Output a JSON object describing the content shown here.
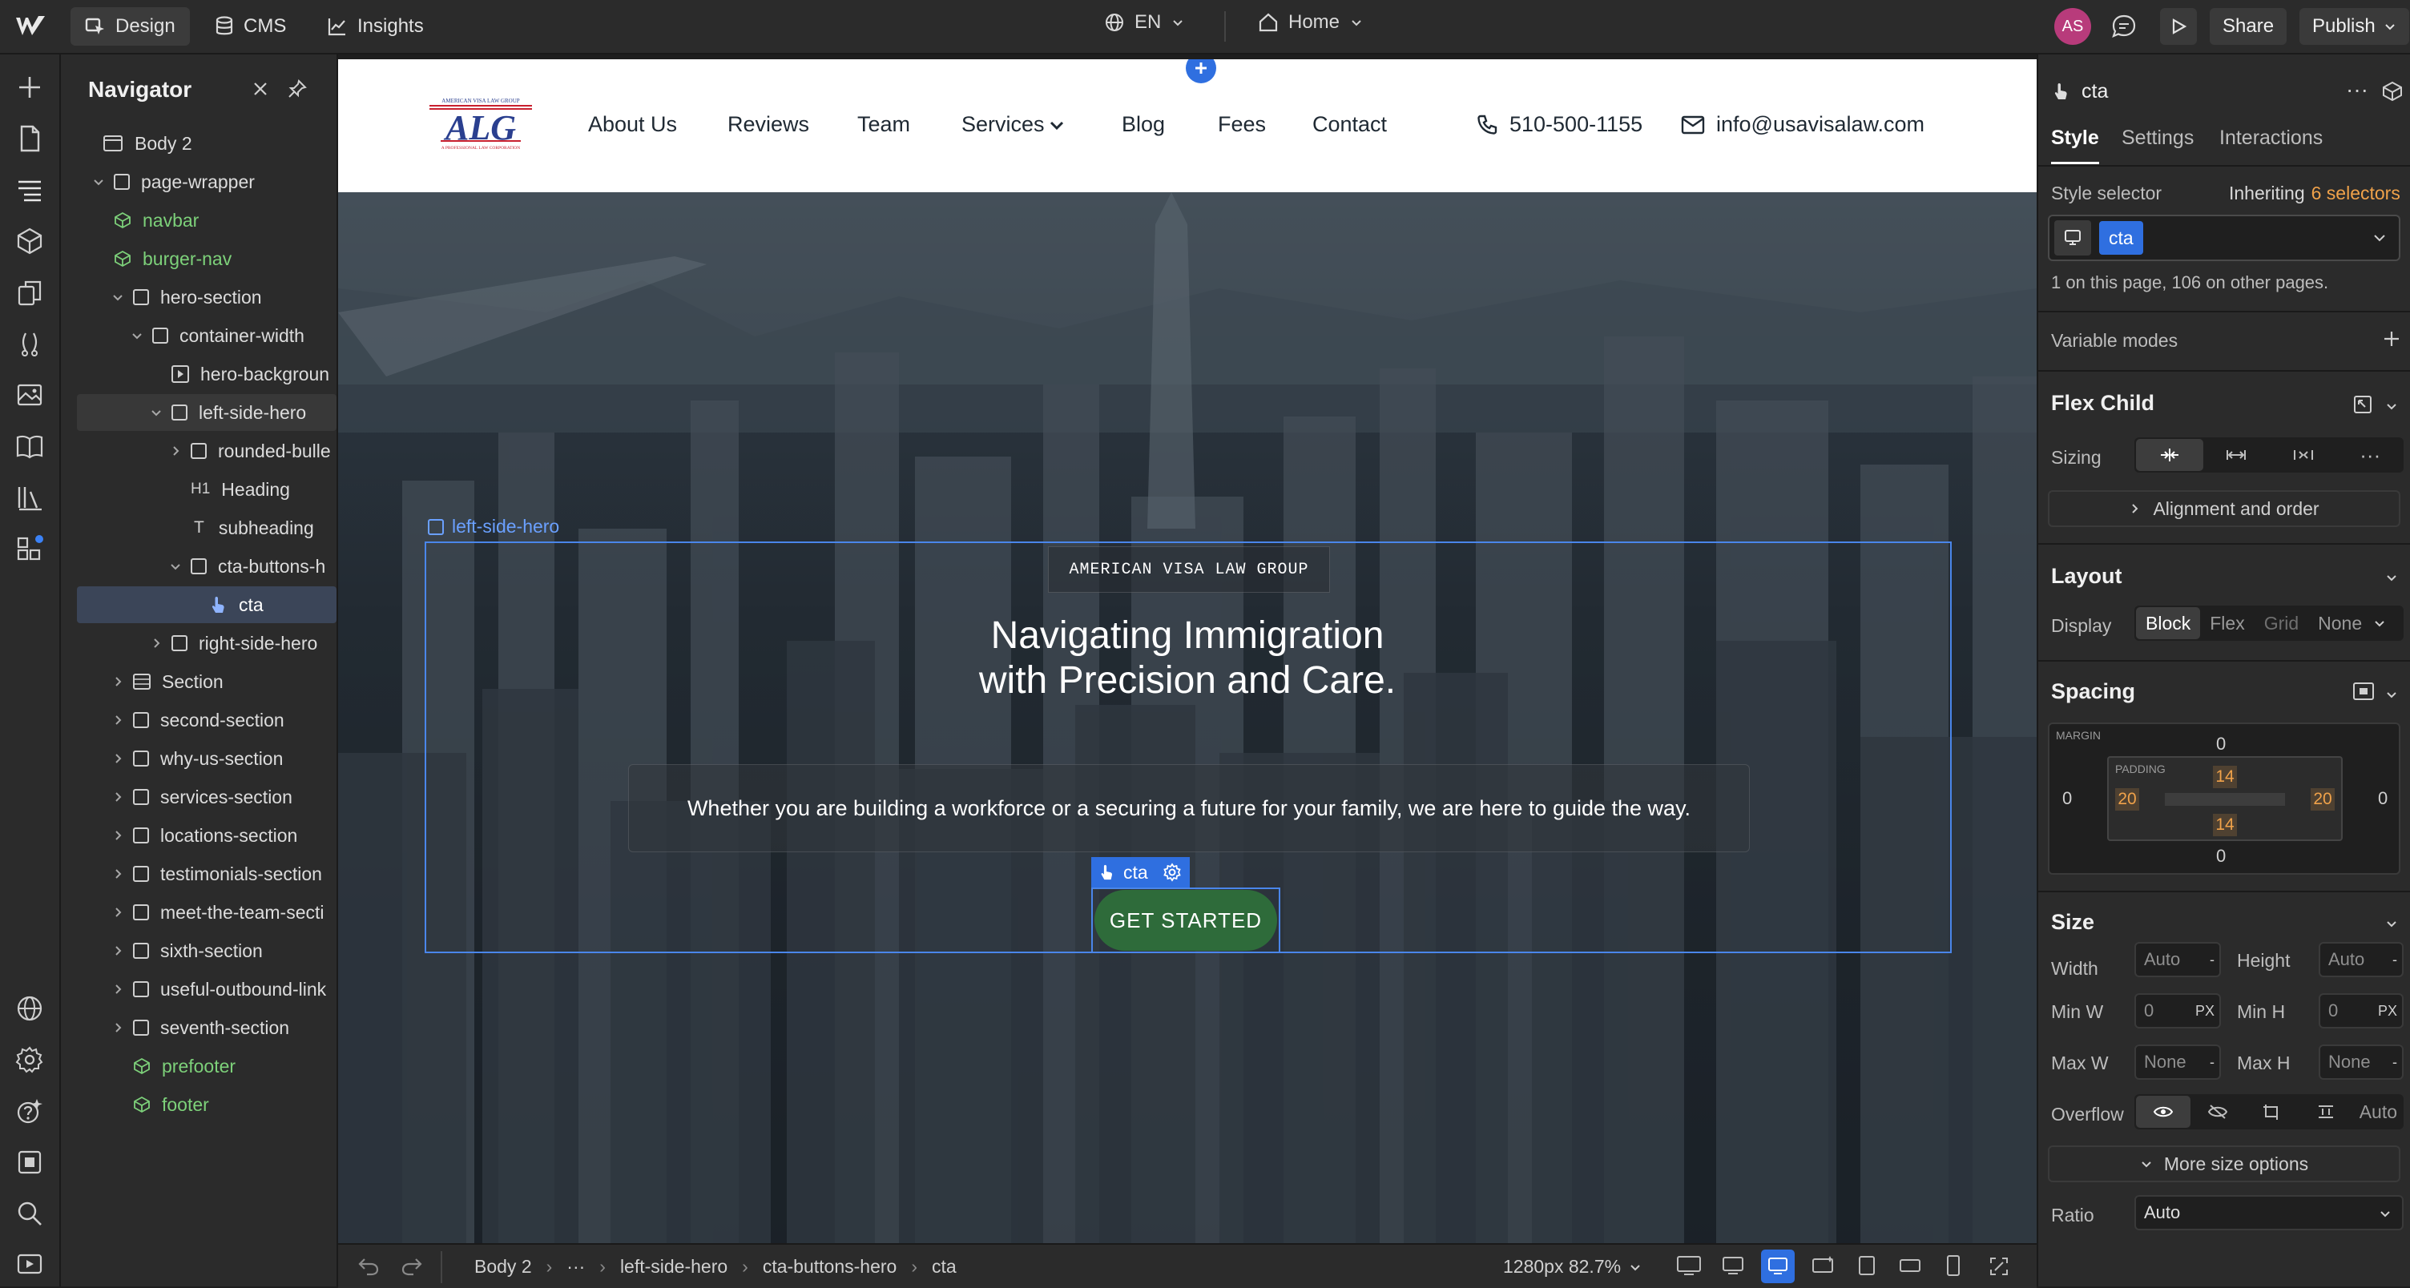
{
  "topbar": {
    "design_label": "Design",
    "cms_label": "CMS",
    "insights_label": "Insights",
    "locale": "EN",
    "page": "Home",
    "avatar_initials": "AS",
    "share_label": "Share",
    "publish_label": "Publish"
  },
  "navigator": {
    "title": "Navigator",
    "items": [
      {
        "label": "Body 2"
      },
      {
        "label": "page-wrapper"
      },
      {
        "label": "navbar"
      },
      {
        "label": "burger-nav"
      },
      {
        "label": "hero-section"
      },
      {
        "label": "container-width"
      },
      {
        "label": "hero-backgroun"
      },
      {
        "label": "left-side-hero"
      },
      {
        "label": "rounded-bulle"
      },
      {
        "label": "Heading",
        "tag": "H1"
      },
      {
        "label": "subheading",
        "tag": "T"
      },
      {
        "label": "cta-buttons-h"
      },
      {
        "label": "cta"
      },
      {
        "label": "right-side-hero"
      },
      {
        "label": "Section"
      },
      {
        "label": "second-section"
      },
      {
        "label": "why-us-section"
      },
      {
        "label": "services-section"
      },
      {
        "label": "locations-section"
      },
      {
        "label": "testimonials-section"
      },
      {
        "label": "meet-the-team-secti"
      },
      {
        "label": "sixth-section"
      },
      {
        "label": "useful-outbound-link"
      },
      {
        "label": "seventh-section"
      },
      {
        "label": "prefooter"
      },
      {
        "label": "footer"
      }
    ]
  },
  "site": {
    "nav_links": [
      "About Us",
      "Reviews",
      "Team",
      "Services",
      "Blog",
      "Fees",
      "Contact"
    ],
    "phone": "510-500-1155",
    "email": "info@usavisalaw.com",
    "logo_text": "ALG",
    "logo_top": "AMERICAN VISA LAW GROUP",
    "logo_bottom": "A PROFESSIONAL LAW CORPORATION",
    "selection_label": "left-side-hero",
    "eyebrow": "AMERICAN VISA LAW GROUP",
    "heading_line1": "Navigating Immigration",
    "heading_line2": "with Precision and Care.",
    "subheading": "Whether you are building a workforce or a securing a future for your family, we are here to guide the way.",
    "cta_tag": "cta",
    "cta_label": "GET STARTED"
  },
  "bottombar": {
    "crumbs": [
      "Body 2",
      "···",
      "left-side-hero",
      "cta-buttons-hero",
      "cta"
    ],
    "viewport": "1280px 82.7%"
  },
  "panel": {
    "element_name": "cta",
    "tabs": [
      "Style",
      "Settings",
      "Interactions"
    ],
    "style_selector_label": "Style selector",
    "inheriting_prefix": "Inheriting",
    "inheriting_count": "6 selectors",
    "class_chip": "cta",
    "usage_note": "1 on this page, 106 on other pages.",
    "variable_modes": "Variable modes",
    "flex_child": "Flex Child",
    "sizing_label": "Sizing",
    "alignment_order": "Alignment and order",
    "layout": "Layout",
    "display_label": "Display",
    "display_options": [
      "Block",
      "Flex",
      "Grid",
      "None"
    ],
    "spacing": "Spacing",
    "margin_label": "MARGIN",
    "padding_label": "PADDING",
    "margin": {
      "top": "0",
      "right": "0",
      "bottom": "0",
      "left": "0"
    },
    "padding": {
      "top": "14",
      "right": "20",
      "bottom": "14",
      "left": "20"
    },
    "size": "Size",
    "width_label": "Width",
    "height_label": "Height",
    "width_value": "Auto",
    "height_value": "Auto",
    "minw_label": "Min W",
    "minh_label": "Min H",
    "minw_value": "0",
    "minh_value": "0",
    "px_unit": "PX",
    "maxw_label": "Max W",
    "maxh_label": "Max H",
    "maxw_value": "None",
    "maxh_value": "None",
    "dash": "-",
    "overflow_label": "Overflow",
    "overflow_auto": "Auto",
    "more_size": "More size options",
    "ratio_label": "Ratio",
    "ratio_value": "Auto"
  },
  "colors": {
    "accent_blue": "#2f6fe0",
    "component_green": "#7dd17a",
    "cta_green": "#2e6b3a",
    "orange": "#f0a24a"
  }
}
